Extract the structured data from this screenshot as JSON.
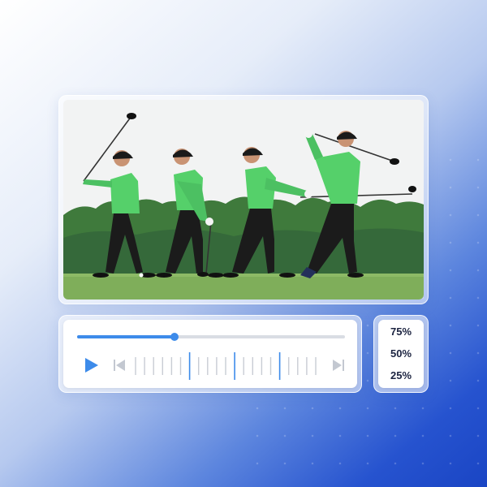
{
  "player": {
    "progress_fraction": 0.365,
    "tick_count": 21,
    "highlighted_ticks": [
      6,
      11,
      16
    ]
  },
  "controls": {
    "play_icon": "play-icon",
    "prev_icon": "skip-back-icon",
    "next_icon": "skip-forward-icon"
  },
  "speed_menu": {
    "options": [
      "75%",
      "50%",
      "25%"
    ]
  },
  "colors": {
    "accent": "#3d8bea",
    "shirt": "#55d06a",
    "grass": "#7fae5a",
    "trees": "#3f7a3c"
  }
}
